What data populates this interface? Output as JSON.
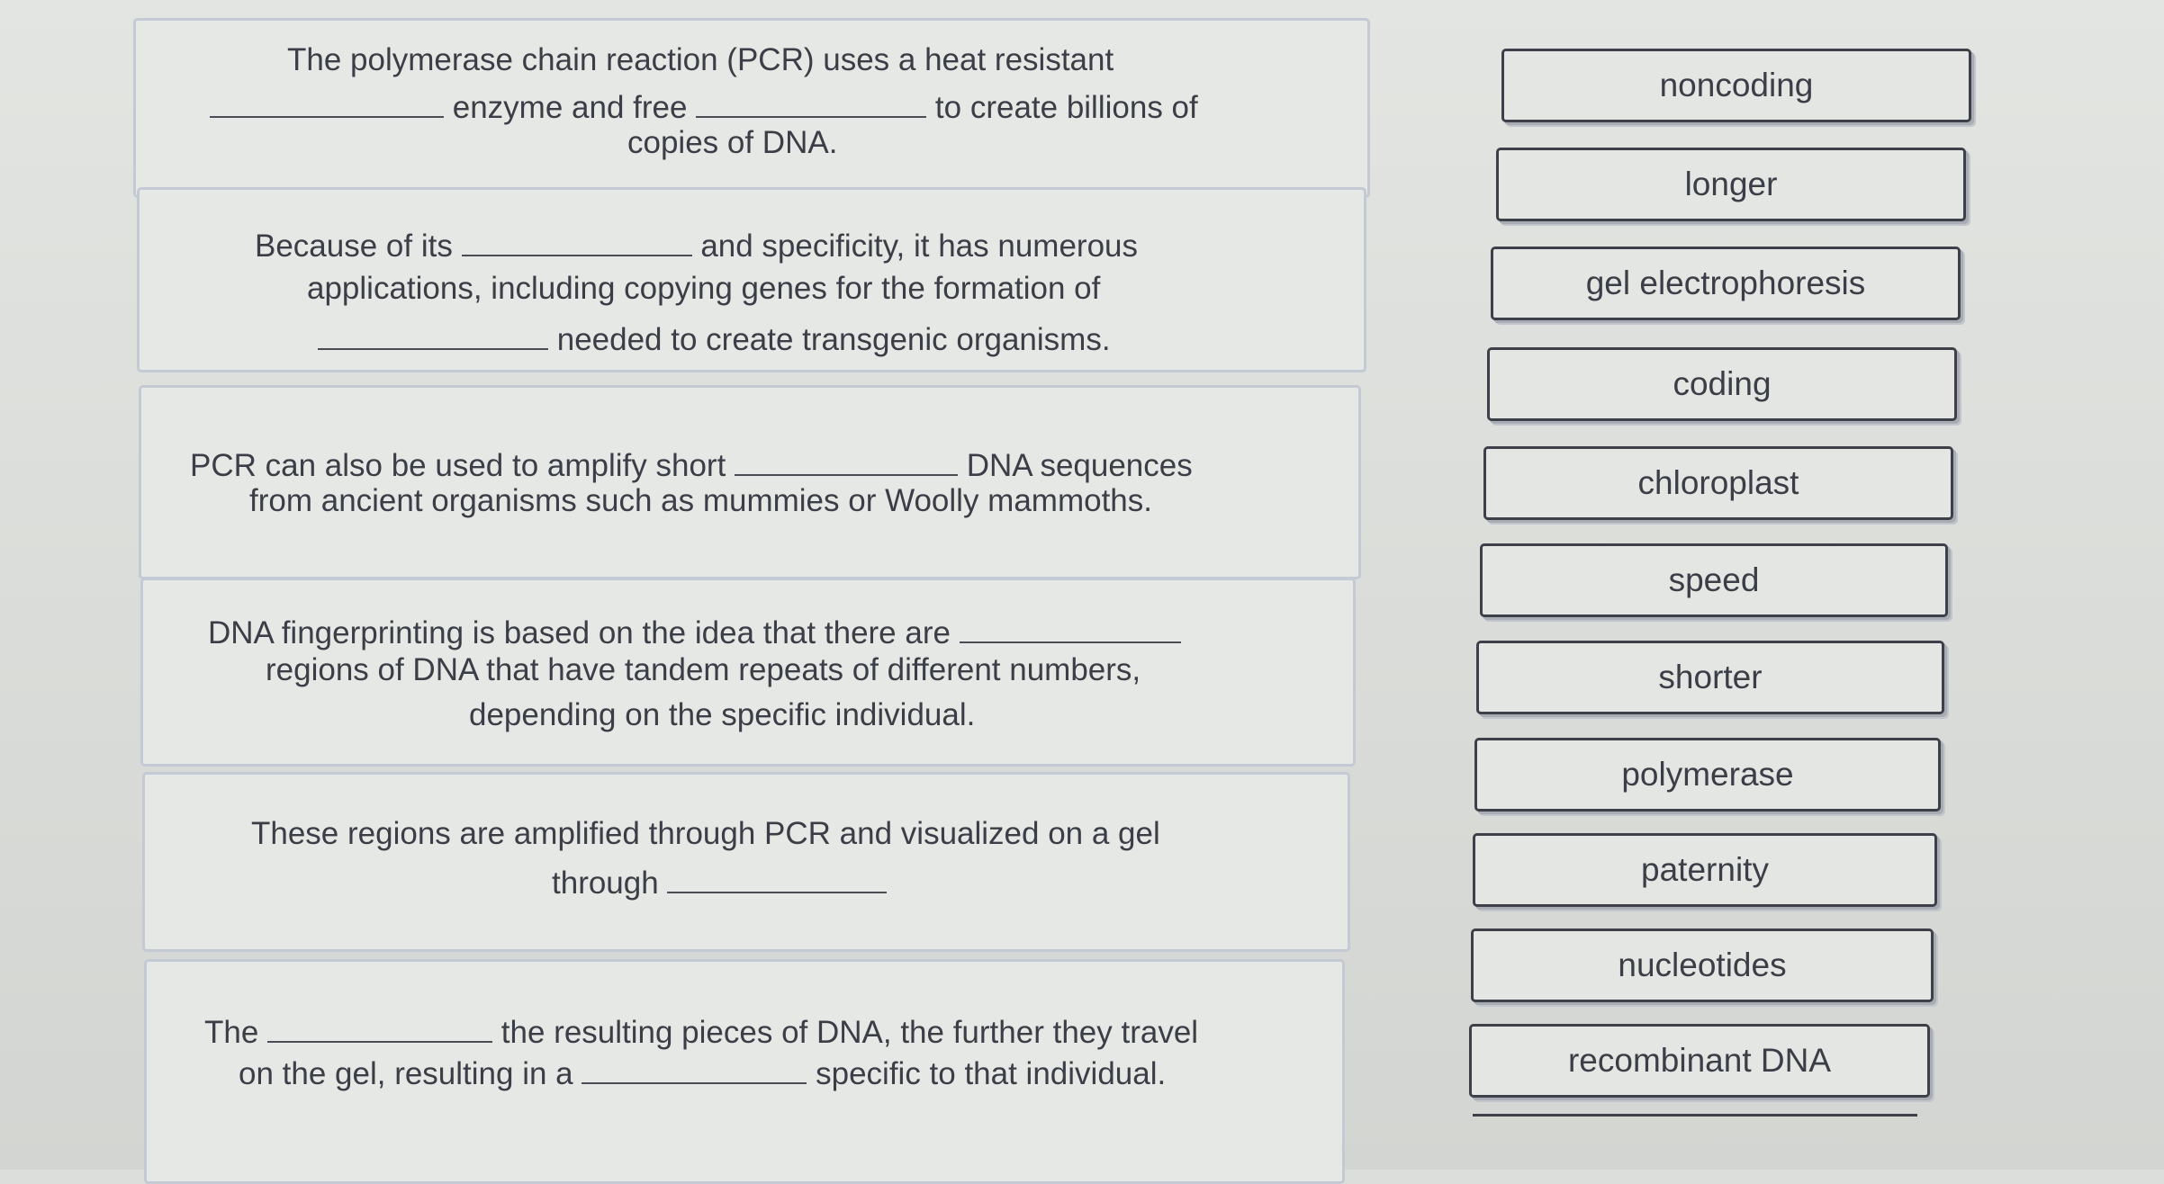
{
  "questions": [
    {
      "lines": [
        {
          "parts": [
            {
              "t": "The polymerase chain reaction (PCR) uses a heat resistant"
            }
          ]
        },
        {
          "parts": [
            {
              "blank": true
            },
            {
              "t": " enzyme and free "
            },
            {
              "blank": true
            },
            {
              "t": " to create billions of"
            }
          ]
        },
        {
          "parts": [
            {
              "t": "copies of DNA."
            }
          ]
        }
      ]
    },
    {
      "lines": [
        {
          "parts": [
            {
              "t": "Because of its "
            },
            {
              "blank": true
            },
            {
              "t": " and specificity, it has numerous"
            }
          ]
        },
        {
          "parts": [
            {
              "t": "applications, including copying genes for the formation of"
            }
          ]
        },
        {
          "parts": [
            {
              "blank": true
            },
            {
              "t": " needed to create transgenic organisms."
            }
          ]
        }
      ]
    },
    {
      "lines": [
        {
          "parts": [
            {
              "t": "PCR can also be used to amplify short "
            },
            {
              "blank": true
            },
            {
              "t": " DNA sequences"
            }
          ]
        },
        {
          "parts": [
            {
              "t": "from ancient organisms such as mummies or Woolly mammoths."
            }
          ]
        }
      ]
    },
    {
      "lines": [
        {
          "parts": [
            {
              "t": "DNA fingerprinting is based on the idea that there are "
            },
            {
              "blank": true
            }
          ]
        },
        {
          "parts": [
            {
              "t": "regions of DNA that have tandem repeats of different numbers,"
            }
          ]
        },
        {
          "parts": [
            {
              "t": "depending on the specific individual."
            }
          ]
        }
      ]
    },
    {
      "lines": [
        {
          "parts": [
            {
              "t": "These regions are amplified through PCR and visualized on a gel"
            }
          ]
        },
        {
          "parts": [
            {
              "t": "through "
            },
            {
              "blank": true
            }
          ]
        }
      ]
    },
    {
      "lines": [
        {
          "parts": [
            {
              "t": "The "
            },
            {
              "blank": true
            },
            {
              "t": " the resulting pieces of DNA, the further they travel"
            }
          ]
        },
        {
          "parts": [
            {
              "t": "on the gel, resulting in a "
            },
            {
              "blank": true
            },
            {
              "t": " specific to that individual."
            }
          ]
        }
      ]
    }
  ],
  "answers": [
    "noncoding",
    "longer",
    "gel electrophoresis",
    "coding",
    "chloroplast",
    "speed",
    "shorter",
    "polymerase",
    "paternity",
    "nucleotides",
    "recombinant DNA"
  ]
}
